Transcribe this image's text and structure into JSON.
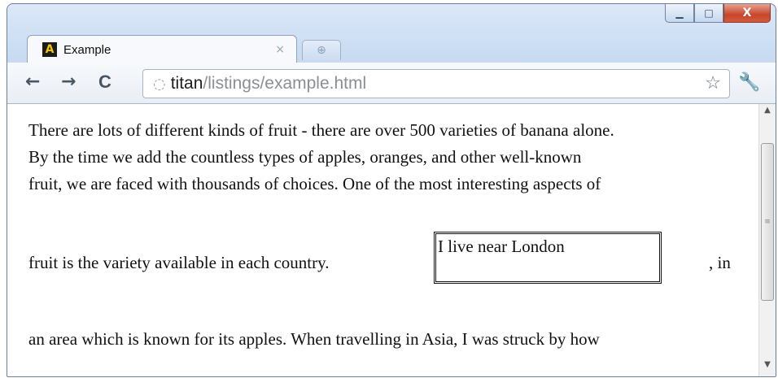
{
  "window": {
    "minimize_glyph": "▁",
    "maximize_glyph": "□",
    "close_glyph": "X"
  },
  "tab": {
    "favicon_letter": "A",
    "title": "Example",
    "close_glyph": "×"
  },
  "toolbar": {
    "back_glyph": "←",
    "forward_glyph": "→",
    "reload_glyph": "C",
    "url_host": "titan",
    "url_path": "/listings/example.html",
    "star_glyph": "☆",
    "wrench_glyph": "🔧"
  },
  "content": {
    "lines": [
      "There are lots of different kinds of fruit - there are over 500 varieties of banana alone.",
      "By the time we add the countless types of apples, oranges, and other well-known",
      "fruit, we are faced with thousands of choices. One of the most interesting aspects of"
    ],
    "inline_before": "fruit is the variety available in each country.",
    "boxed_text": "I live near London",
    "inline_after": ", in",
    "last_line": "an area which is known for its apples. When travelling in Asia, I was struck by how"
  },
  "colors": {
    "frame": "#c9dcf2",
    "close_button": "#c7452b",
    "text": "#111111"
  }
}
